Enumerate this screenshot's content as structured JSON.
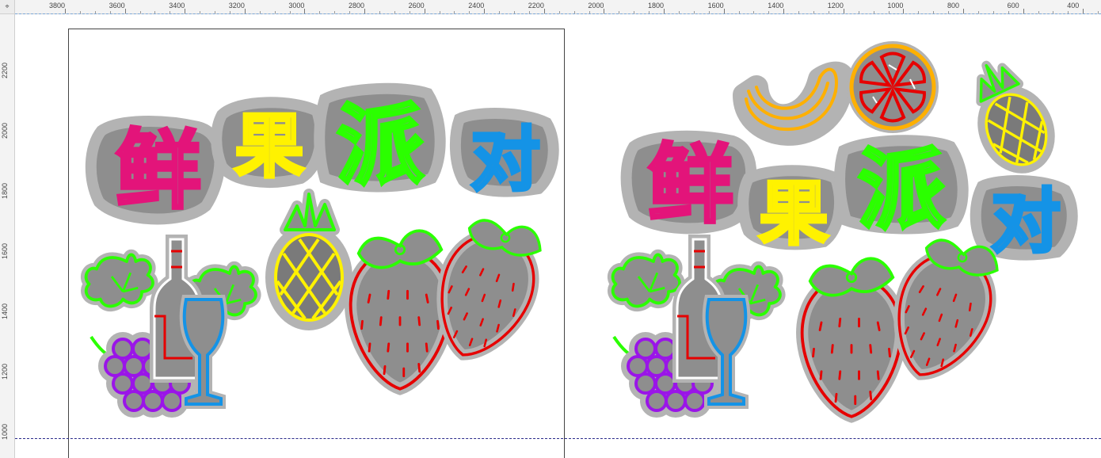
{
  "ruler": {
    "corner_label": "⌖",
    "top_labels": [
      "3800",
      "3600",
      "3400",
      "3200",
      "3000",
      "2800",
      "2600",
      "2400",
      "2200",
      "2000",
      "1800",
      "1600",
      "1400",
      "1200",
      "1000",
      "800",
      "600",
      "400"
    ],
    "left_labels": [
      "2200",
      "2000",
      "1800",
      "1600",
      "1400",
      "1200",
      "1000"
    ]
  },
  "design": {
    "title_chars": [
      "鲜",
      "果",
      "派",
      "对"
    ],
    "colors": {
      "pink": "#e3147a",
      "yellow": "#fff200",
      "green": "#2bff00",
      "blue": "#1493e6",
      "red": "#e60000",
      "purple": "#9a15e8",
      "orange": "#ffb000",
      "backing": "#8e8e8e",
      "backing_outline": "#b3b3b3"
    },
    "icons": [
      "grape-vine-icon",
      "wine-bottle-icon",
      "wine-glass-icon",
      "pineapple-icon",
      "strawberry-icon",
      "banana-icon",
      "orange-slice-icon"
    ]
  }
}
